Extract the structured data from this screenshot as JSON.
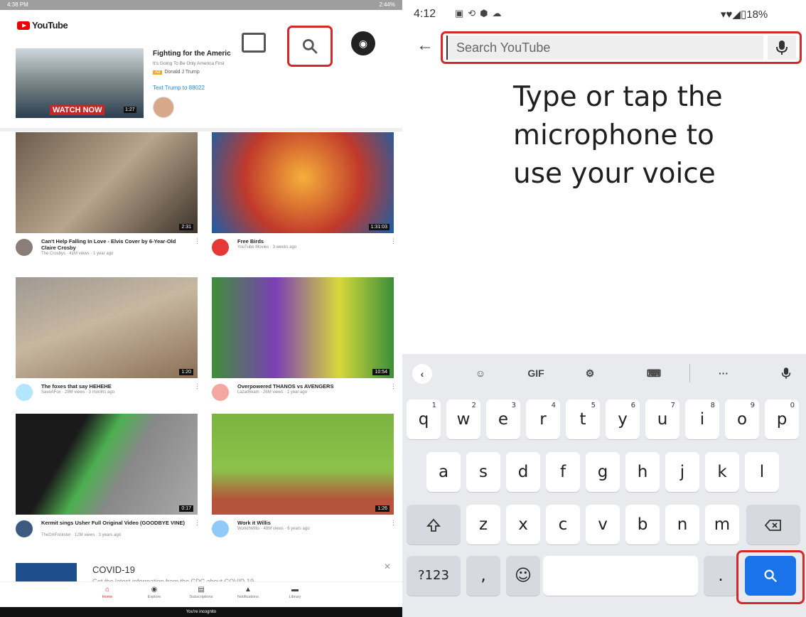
{
  "left": {
    "status_time": "4:38 PM",
    "status_right": "2:44%",
    "logo_text": "YouTube",
    "ad": {
      "title": "Fighting for the Americ",
      "subtitle": "It's Going To Be Only America First",
      "badge": "Ad",
      "advertiser": "Donald J Trump",
      "cta": "Text Trump to 88022",
      "watch_label": "WATCH NOW",
      "duration": "1:27"
    },
    "videos": [
      {
        "title": "Can't Help Falling In Love - Elvis Cover by 6-Year-Old Claire Crosby",
        "sub": "The Crosbys · 41M views · 1 year ago",
        "duration": "2:31"
      },
      {
        "title": "Free Birds",
        "sub": "YouTube Movies · 3 weeks ago",
        "duration": "1:31:03"
      },
      {
        "title": "The foxes that say HEHEHE",
        "sub": "SaveAFox · 29M views · 3 months ago",
        "duration": "1:20"
      },
      {
        "title": "Overpowered THANOS vs AVENGERS",
        "sub": "LazarBeam · 26M views · 1 year ago",
        "duration": "10:54"
      },
      {
        "title": "Kermit sings Usher Full Original Video (GOODBYE VINE)",
        "sub": "TheDAFrickster · 12M views · 3 years ago",
        "duration": "0:17"
      },
      {
        "title": "Work it Willis",
        "sub": "WorkItWillis · 48M views · 6 years ago",
        "duration": "1:26"
      }
    ],
    "covid": {
      "title": "COVID-19",
      "subtitle": "Get the latest information from the CDC about COVID-19"
    },
    "nav": [
      {
        "label": "Home",
        "icon": "home-icon"
      },
      {
        "label": "Explore",
        "icon": "compass-icon"
      },
      {
        "label": "Subscriptions",
        "icon": "subscriptions-icon"
      },
      {
        "label": "Notifications",
        "icon": "bell-icon"
      },
      {
        "label": "Library",
        "icon": "folder-icon"
      }
    ],
    "incognito_text": "You're incognito"
  },
  "right": {
    "status_time": "4:12",
    "battery": "18%",
    "search": {
      "placeholder": "Search YouTube"
    },
    "prompt": "Type or tap the microphone to use your voice",
    "keyboard": {
      "toolbar": {
        "gif": "GIF",
        "more": "···"
      },
      "row1": [
        "q",
        "w",
        "e",
        "r",
        "t",
        "y",
        "u",
        "i",
        "o",
        "p"
      ],
      "row1_hints": [
        "1",
        "2",
        "3",
        "4",
        "5",
        "6",
        "7",
        "8",
        "9",
        "0"
      ],
      "row2": [
        "a",
        "s",
        "d",
        "f",
        "g",
        "h",
        "j",
        "k",
        "l"
      ],
      "row3": [
        "z",
        "x",
        "c",
        "v",
        "b",
        "n",
        "m"
      ],
      "symbols_key": "?123",
      "comma_key": ",",
      "period_key": "."
    }
  }
}
